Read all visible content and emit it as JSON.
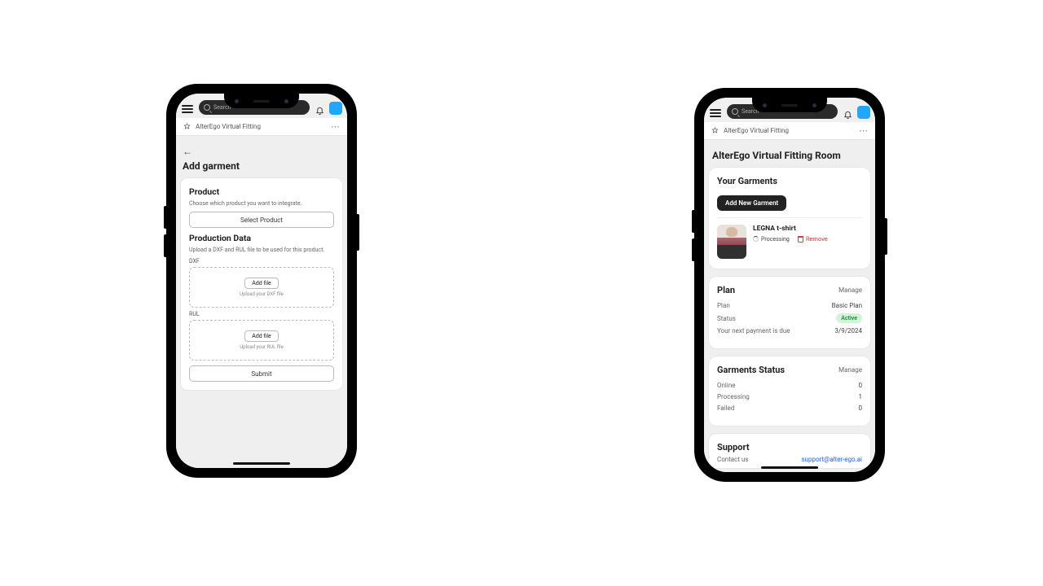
{
  "top": {
    "search_placeholder": "Search"
  },
  "subheader": {
    "app_title": "AlterEgo Virtual Fitting"
  },
  "left": {
    "page_title": "Add garment",
    "section_product_title": "Product",
    "section_product_desc": "Choose which product you want to integrate.",
    "select_product_label": "Select Product",
    "section_pd_title": "Production Data",
    "section_pd_desc": "Upload a DXF and RUL file to be used for this product.",
    "dxf_label": "DXF",
    "rul_label": "RUL",
    "add_file_label": "Add file",
    "dxf_hint": "Upload your DXF file",
    "rul_hint": "Upload your RUL file",
    "submit_label": "Submit"
  },
  "right": {
    "page_title": "AlterEgo Virtual Fitting Room",
    "garments_title": "Your Garments",
    "add_new_label": "Add New Garment",
    "garment_name": "LEGNA t-shirt",
    "garment_status": "Processing",
    "remove_label": "Remove",
    "plan_title": "Plan",
    "manage_label": "Manage",
    "plan_key": "Plan",
    "plan_value": "Basic Plan",
    "status_key": "Status",
    "status_value": "Active",
    "due_key": "Your next payment is due",
    "due_value": "3/9/2024",
    "gs_title": "Garments Status",
    "gs_online_key": "Online",
    "gs_online_val": "0",
    "gs_processing_key": "Processing",
    "gs_processing_val": "1",
    "gs_failed_key": "Failed",
    "gs_failed_val": "0",
    "support_title": "Support",
    "support_key": "Contact us",
    "support_link": "support@alter-ego.ai"
  }
}
